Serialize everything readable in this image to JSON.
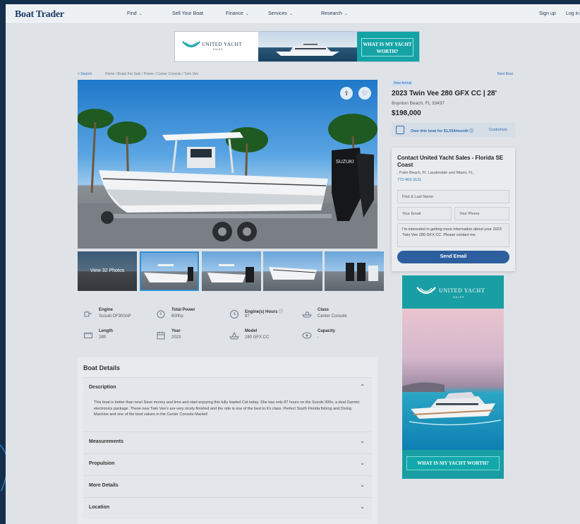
{
  "nav": {
    "logo": "Boat Trader",
    "items": [
      {
        "label": "Find",
        "has_menu": true
      },
      {
        "label": "Sell Your Boat",
        "has_menu": false
      },
      {
        "label": "Finance",
        "has_menu": true
      },
      {
        "label": "Services",
        "has_menu": true
      },
      {
        "label": "Research",
        "has_menu": true
      }
    ],
    "sign_up": "Sign up",
    "log_in": "Log in"
  },
  "top_ad": {
    "brand": "UNITED YACHT",
    "brand_sub": "SALES",
    "cta": "WHAT IS MY YACHT WORTH?"
  },
  "breadcrumb": {
    "back": "< Search",
    "path": "Home / Boats For Sale / Power / Center Console / Twin Vee",
    "next": "Next Boat"
  },
  "gallery": {
    "view_photos": "View 32 Photos"
  },
  "specs": [
    {
      "label": "Engine",
      "value": "Suzuki DF300AP",
      "icon": "engine-icon"
    },
    {
      "label": "Total Power",
      "value": "600hp",
      "icon": "power-icon"
    },
    {
      "label": "Engine(s) Hours",
      "value": "87",
      "icon": "clock-icon"
    },
    {
      "label": "Class",
      "value": "Center Console",
      "icon": "boat-class-icon"
    },
    {
      "label": "Length",
      "value": "28ft",
      "icon": "length-icon"
    },
    {
      "label": "Year",
      "value": "2023",
      "icon": "calendar-icon"
    },
    {
      "label": "Model",
      "value": "280 GFX CC",
      "icon": "model-icon"
    },
    {
      "label": "Capacity",
      "value": "-",
      "icon": "capacity-icon"
    }
  ],
  "details": {
    "title": "Boat Details",
    "description_title": "Description",
    "description": "This boat is better than new! Save money and time and start enjoying this fully loaded Cat today. She has only 87 hours on the Suzuki 300s, a dual Garmin electronics package. These new Twin Vee's are very nicely finished and the ride is one of the best in it's class. Perfect  South Florida fishing and Diving Machine and one of the best values in the Center Console Market!",
    "sections": [
      "Measurements",
      "Propulsion",
      "More Details",
      "Location"
    ]
  },
  "listing": {
    "badge": "New Arrival",
    "title": "2023 Twin Vee 280 GFX CC | 28'",
    "location": "Boynton Beach, FL 33437",
    "price": "$198,000",
    "finance_text": "Own this boat for $1,554/month",
    "customize": "Customize"
  },
  "contact": {
    "title": "Contact United Yacht Sales - Florida SE Coast",
    "address": ", Palm Beach, Ft. Lauderdale and Miami, FL,",
    "phone": "772-463-3131",
    "name_placeholder": "First & Last Name",
    "email_placeholder": "Your Email",
    "phone_placeholder": "Your Phone",
    "message": "I'm interested in getting more information about your 2023 Twin Vee 280 GFX CC. Please contact me.",
    "send": "Send Email"
  },
  "side_ad": {
    "brand": "UNITED YACHT",
    "brand_sub": "SALES",
    "cta": "WHAT IS MY YACHT WORTH?"
  },
  "colors": {
    "link": "#2d6db5",
    "button": "#2d5e9e",
    "ad_teal": "#14a4a6",
    "page_bg": "#dfe3e8"
  }
}
